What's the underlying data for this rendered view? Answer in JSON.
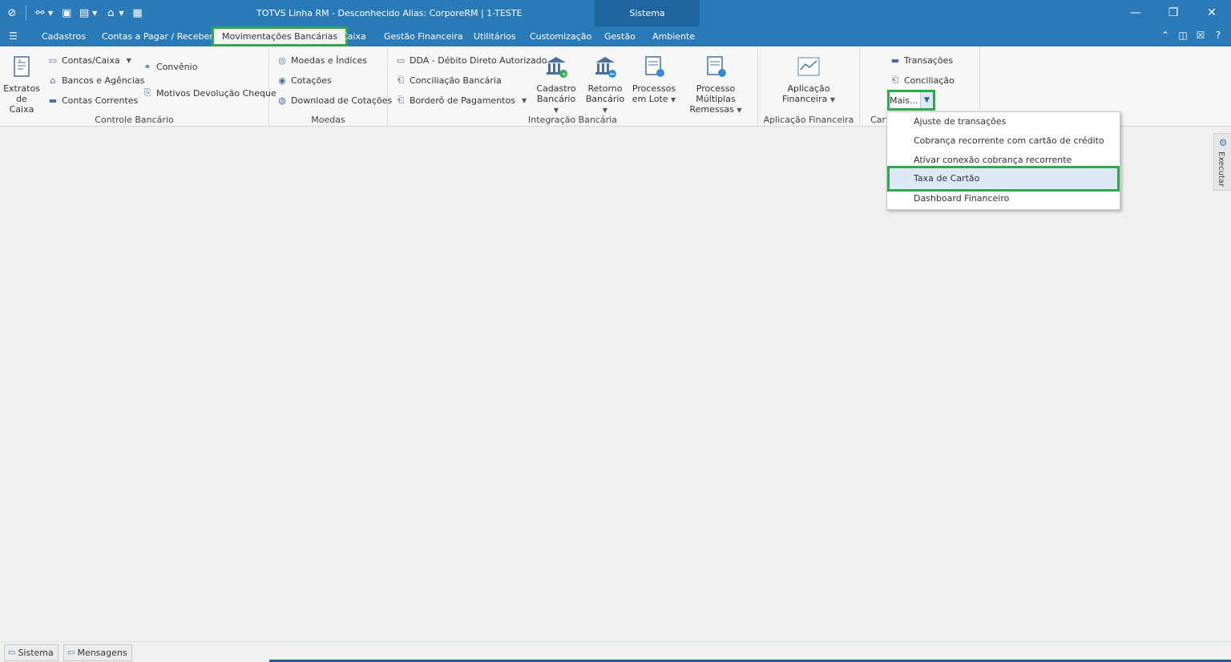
{
  "titlebar": {
    "title": "TOTVS Linha RM - Desconhecido  Alias: CorporeRM | 1-TESTE",
    "context_tab": "Sistema"
  },
  "tabs": [
    {
      "label": "Cadastros"
    },
    {
      "label": "Contas a Pagar / Receber"
    },
    {
      "label": "Movimentações Bancárias"
    },
    {
      "label": "Caixa"
    },
    {
      "label": "Gestão Financeira"
    },
    {
      "label": "Utilitários"
    },
    {
      "label": "Customização"
    },
    {
      "label": "Gestão"
    },
    {
      "label": "Ambiente"
    }
  ],
  "ribbon": {
    "controle": {
      "label": "Controle Bancário",
      "extratos_1": "Extratos",
      "extratos_2": "de Caixa",
      "contas_caixa": "Contas/Caixa",
      "bancos": "Bancos e Agências",
      "contas_correntes": "Contas Correntes",
      "convenio": "Convênio",
      "motivos": "Motivos Devolução Cheque"
    },
    "moedas": {
      "label": "Moedas",
      "moedas_indices": "Moedas e Índices",
      "cotacoes": "Cotações",
      "download": "Download de Cotações"
    },
    "integracao": {
      "label": "Integração Bancária",
      "dda": "DDA - Débito Direto Autorizado",
      "conciliacao": "Conciliação Bancária",
      "bordero": "Borderô de Pagamentos",
      "cadastro_1": "Cadastro",
      "cadastro_2": "Bancário",
      "retorno_1": "Retorno",
      "retorno_2": "Bancário",
      "processos_1": "Processos",
      "processos_2": "em Lote",
      "multiplas_1": "Processo Múltiplas",
      "multiplas_2": "Remessas"
    },
    "aplicacao": {
      "label": "Aplicação Financeira",
      "btn_1": "Aplicação",
      "btn_2": "Financeira"
    },
    "cartao": {
      "label": "Cart",
      "transacoes": "Transações",
      "conciliacao": "Conciliação",
      "mais": "Mais..."
    }
  },
  "dropdown": {
    "items": [
      {
        "label": "Ajuste de transações"
      },
      {
        "label": "Cobrança recorrente com cartão de crédito"
      },
      {
        "label": "Ativar conexão cobrança recorrente"
      },
      {
        "label": "Taxa de Cartão"
      },
      {
        "label": "Dashboard Financeiro"
      }
    ]
  },
  "side": {
    "executar": "Executar"
  },
  "status": {
    "sistema": "Sistema",
    "mensagens": "Mensagens"
  },
  "colors": {
    "accent": "#2b7ab8",
    "highlight": "#2fa84f"
  }
}
